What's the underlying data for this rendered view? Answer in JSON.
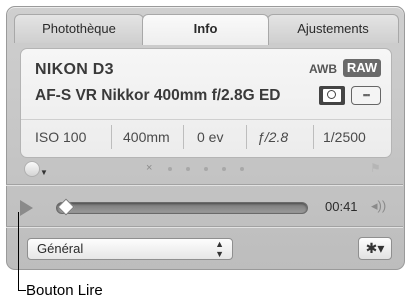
{
  "tabs": [
    {
      "label": "Photothèque"
    },
    {
      "label": "Info"
    },
    {
      "label": "Ajustements"
    }
  ],
  "info": {
    "camera": "NIKON D3",
    "lens": "AF-S VR Nikkor 400mm f/2.8G ED",
    "awb": "AWB",
    "raw": "RAW",
    "exif": {
      "iso": "ISO 100",
      "focal": "400mm",
      "ev": "0 ev",
      "aperture": "ƒ/2.8",
      "shutter": "1/2500"
    }
  },
  "rating": {
    "reject": "×",
    "stars_max": 5,
    "stars": 0
  },
  "player": {
    "time": "00:41",
    "position_fraction": 0.0
  },
  "preset": {
    "selected": "Général"
  },
  "callout": {
    "label": "Bouton Lire"
  },
  "icons": {
    "play": "play-icon",
    "volume": "volume-icon",
    "gear": "gear-icon",
    "flag": "flag-icon",
    "metering": "metering-icon",
    "af_points": "af-points-icon"
  }
}
